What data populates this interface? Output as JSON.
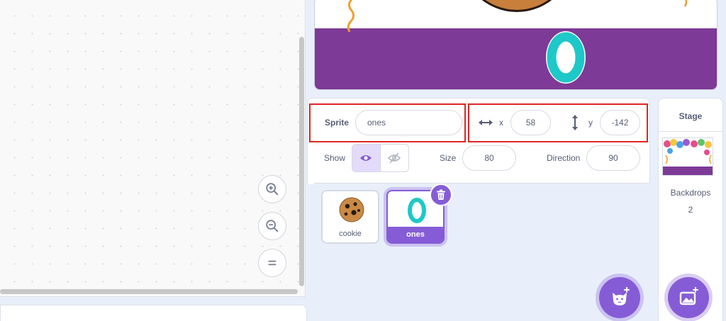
{
  "sprite_info": {
    "sprite_label": "Sprite",
    "sprite_name": "ones",
    "x_label": "x",
    "x_value": "58",
    "y_label": "y",
    "y_value": "-142",
    "show_label": "Show",
    "size_label": "Size",
    "size_value": "80",
    "direction_label": "Direction",
    "direction_value": "90"
  },
  "sprites": [
    {
      "name": "cookie",
      "selected": false,
      "icon": "cookie-icon"
    },
    {
      "name": "ones",
      "selected": true,
      "icon": "digit-zero-icon"
    }
  ],
  "stage_display": {
    "digit": "0",
    "digit_color": "#1ec8c8",
    "banner_color": "#7d3a96"
  },
  "stage_pane": {
    "title": "Stage",
    "backdrops_label": "Backdrops",
    "backdrops_count": "2"
  },
  "zoom_controls": [
    "zoom-in-icon",
    "zoom-out-icon",
    "zoom-reset-icon"
  ],
  "colors": {
    "accent": "#855cd6",
    "highlight": "#e02424"
  }
}
